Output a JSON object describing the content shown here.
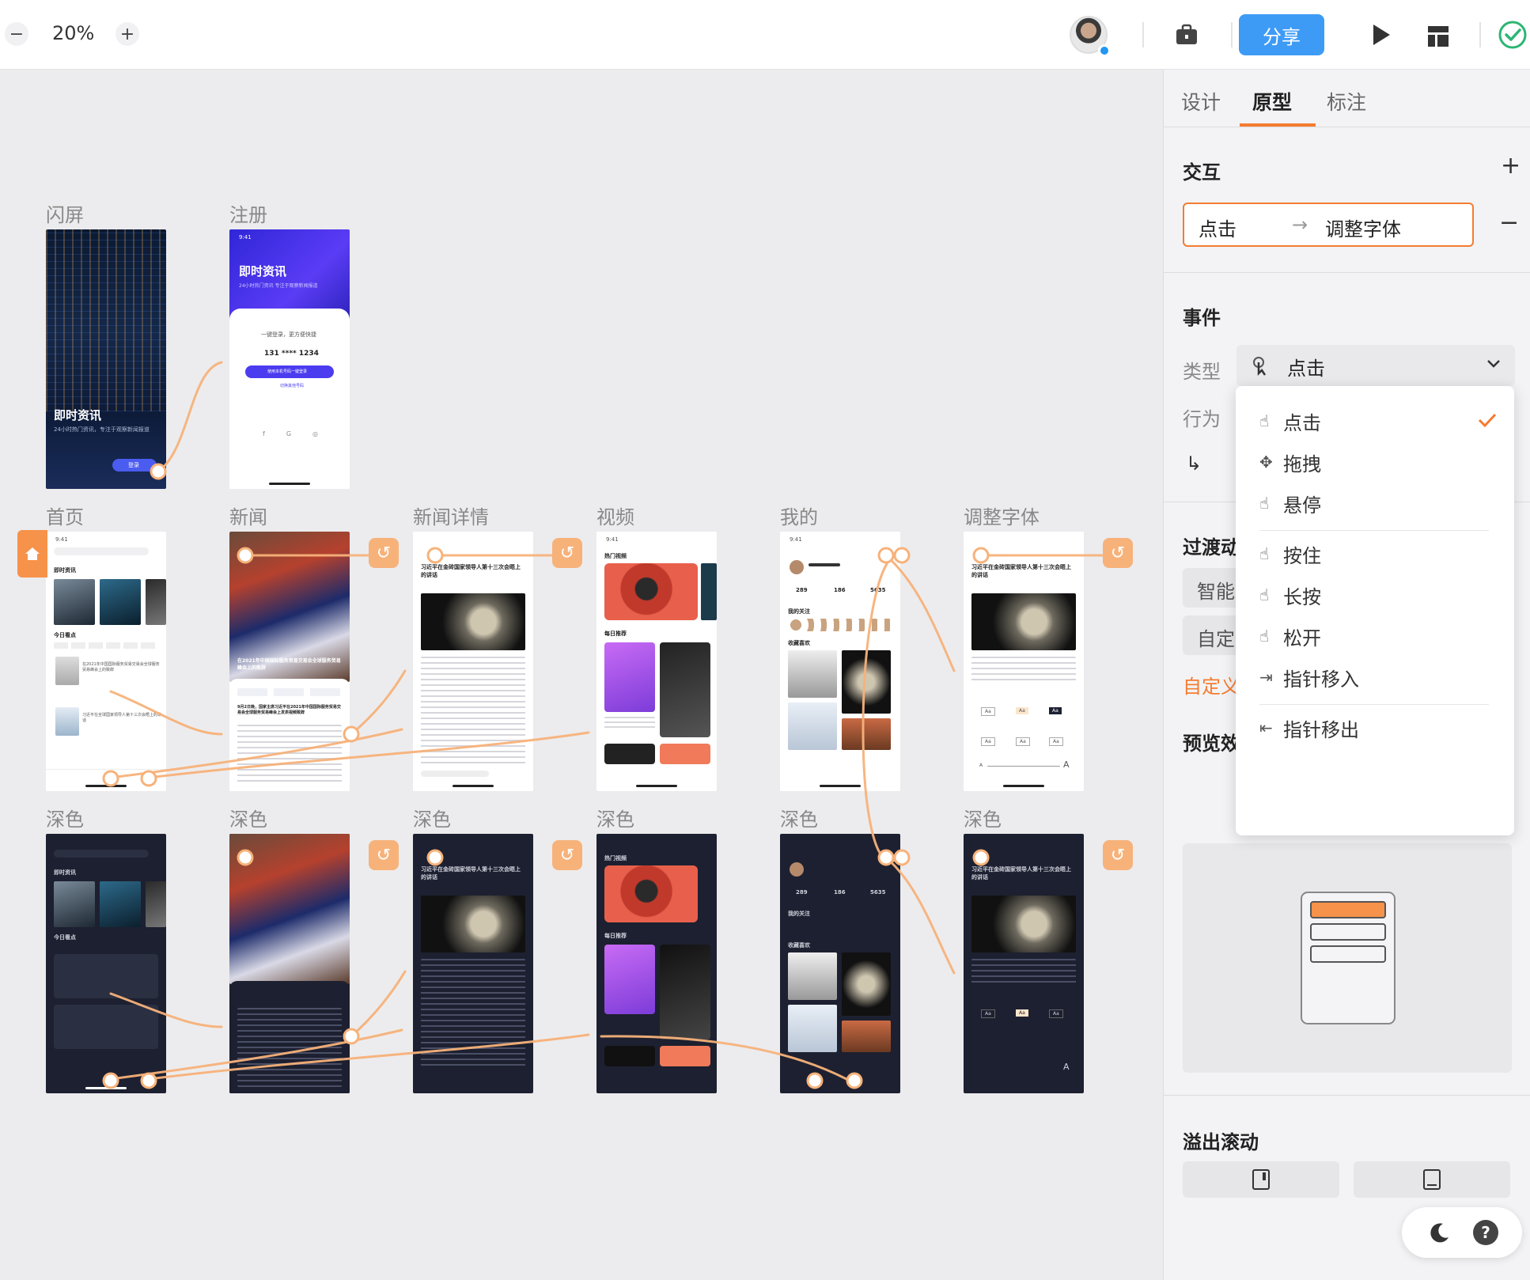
{
  "toolbar": {
    "zoom_out": "−",
    "zoom_value": "20%",
    "zoom_in": "+",
    "share_label": "分享"
  },
  "panel": {
    "tabs": [
      "设计",
      "原型",
      "标注"
    ],
    "interaction_title": "交互",
    "interaction_add": "+",
    "interaction_remove": "−",
    "interaction_trigger": "点击",
    "interaction_target": "调整字体",
    "event_title": "事件",
    "type_label": "类型",
    "type_value": "点击",
    "action_label": "行为",
    "transition_title": "过渡动",
    "smart_option": "智能",
    "custom_option": "自定",
    "custom_link": "自定义",
    "preview_title": "预览效",
    "overflow_title": "溢出滚动"
  },
  "dropdown": {
    "items": [
      "点击",
      "拖拽",
      "悬停",
      "按住",
      "长按",
      "松开",
      "指针移入",
      "指针移出"
    ],
    "selected": "点击"
  },
  "canvas": {
    "row1_labels": [
      "闪屏",
      "注册"
    ],
    "row2_labels": [
      "首页",
      "新闻",
      "新闻详情",
      "视频",
      "我的",
      "调整字体"
    ],
    "row3_labels": [
      "深色",
      "深色",
      "深色",
      "深色",
      "深色",
      "深色"
    ],
    "splash": {
      "title": "即时资讯",
      "desc": "24小时热门资讯，专注于观察新闻报道",
      "button": "登录"
    },
    "register": {
      "time": "9:41",
      "title": "即时资讯",
      "subtitle": "24小时热门资讯 专注于观察新闻报道",
      "prompt": "一键登录，更方便快捷",
      "phone": "131 **** 1234",
      "cta": "使用本机号码一键登录",
      "alt": "切换其他号码"
    },
    "home": {
      "time": "9:41",
      "section1": "即时资讯",
      "section2": "今日看点",
      "item1": "在2021年中国国际服务贸易交易会全球服务贸易峰会上的致辞",
      "item2": "习近平在全球国家领导人第十三次会晤上的讲话"
    },
    "news": {
      "headline": "在2021年中国国际服务贸易交易会全球服务贸易峰会上的致辞",
      "date": "9月2日晚，国家主席习近平在2021年中国国际服务贸易交易会全球服务贸易峰会上发表视频致辞"
    },
    "detail": {
      "title": "习近平在金砖国家领导人第十三次会晤上的讲话"
    },
    "video": {
      "time": "9:41",
      "section1": "热门视频",
      "section2": "每日推荐"
    },
    "mine": {
      "time": "9:41",
      "stats": [
        "289",
        "186",
        "5635"
      ],
      "section1": "我的关注",
      "section2": "收藏喜欢"
    },
    "font": {
      "title": "习近平在金砖国家领导人第十三次会晤上的讲话",
      "samples": [
        "Aa",
        "Aa",
        "Aa",
        "Aa",
        "Aa",
        "Aa"
      ],
      "big_a": "A",
      "small_a": "A"
    }
  },
  "colors": {
    "accent": "#f47c30",
    "share_blue": "#3d9bf6",
    "link_orange": "#f7b27a",
    "dark_frame": "#1d2030",
    "success_green": "#2bb673"
  },
  "icons": [
    "zoom-out-icon",
    "zoom-in-icon",
    "briefcase-icon",
    "play-icon",
    "layout-icon",
    "check-circle-icon",
    "plus-icon",
    "minus-icon",
    "arrow-right-icon",
    "chevron-down-icon",
    "tap-icon",
    "drag-icon",
    "hover-icon",
    "press-icon",
    "long-press-icon",
    "release-icon",
    "pointer-enter-icon",
    "pointer-leave-icon",
    "checkmark-icon",
    "return-arrow-icon",
    "moon-icon",
    "help-icon",
    "back-icon",
    "home-icon"
  ]
}
